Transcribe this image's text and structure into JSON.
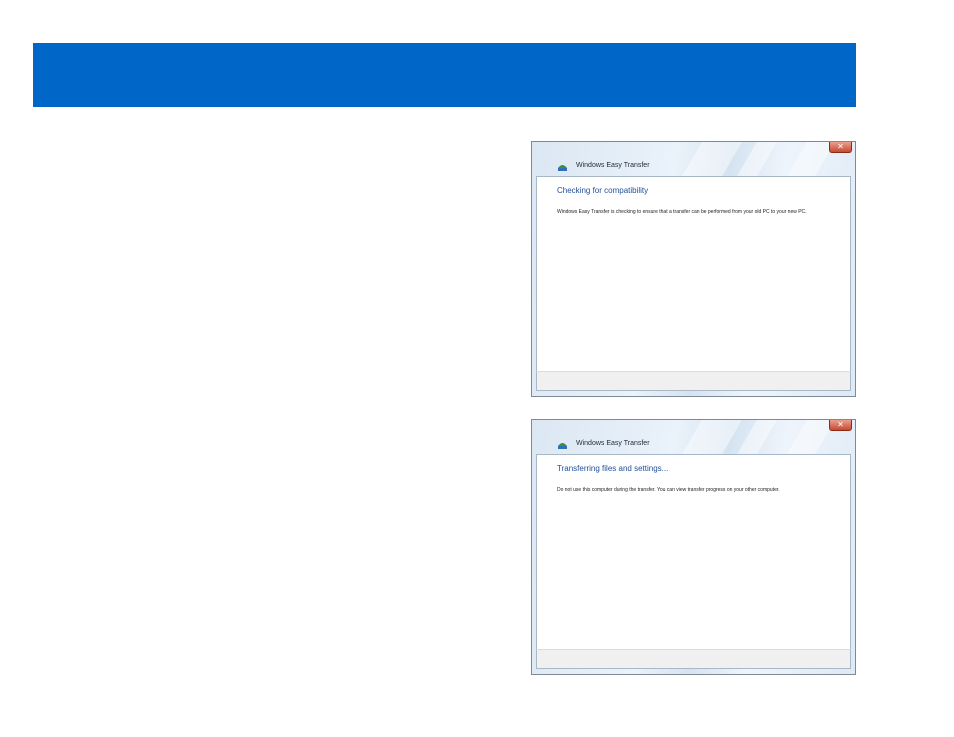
{
  "windows": [
    {
      "title": "Windows Easy Transfer",
      "close_glyph": "✕",
      "icon": "easy-transfer-icon",
      "heading": "Checking for compatibility",
      "body": "Windows Easy Transfer is checking to ensure that a transfer can be performed from your old PC to your new PC."
    },
    {
      "title": "Windows Easy Transfer",
      "close_glyph": "✕",
      "icon": "easy-transfer-icon",
      "heading": "Transferring files and settings...",
      "body": "Do not use this computer during the transfer. You can view transfer progress on your other computer."
    }
  ],
  "colors": {
    "title_bar": "#0066c8",
    "heading_text": "#1f4e9c",
    "close_button": "#c74a32"
  }
}
